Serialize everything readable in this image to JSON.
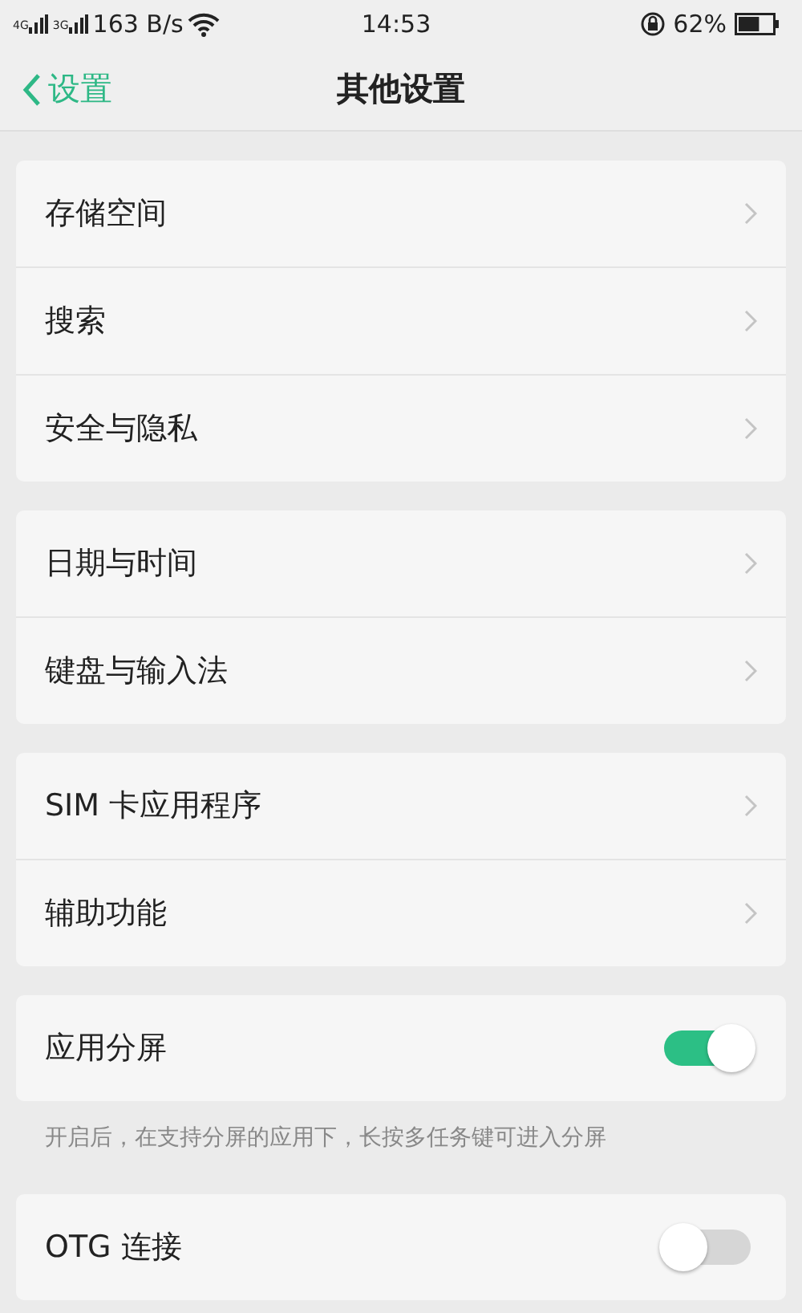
{
  "status_bar": {
    "sim1": "4G",
    "sim2": "3G",
    "speed": "163 B/s",
    "time": "14:53",
    "battery": "62%"
  },
  "header": {
    "back": "设置",
    "title": "其他设置"
  },
  "groups": [
    {
      "rows": [
        {
          "label": "存储空间",
          "kind": "link"
        },
        {
          "label": "搜索",
          "kind": "link"
        },
        {
          "label": "安全与隐私",
          "kind": "link"
        }
      ]
    },
    {
      "rows": [
        {
          "label": "日期与时间",
          "kind": "link"
        },
        {
          "label": "键盘与输入法",
          "kind": "link"
        }
      ]
    },
    {
      "rows": [
        {
          "label": "SIM 卡应用程序",
          "kind": "link"
        },
        {
          "label": "辅助功能",
          "kind": "link"
        }
      ]
    },
    {
      "rows": [
        {
          "label": "应用分屏",
          "kind": "toggle",
          "on": true
        }
      ],
      "note": "开启后，在支持分屏的应用下，长按多任务键可进入分屏"
    },
    {
      "rows": [
        {
          "label": "OTG 连接",
          "kind": "toggle",
          "on": false
        }
      ]
    }
  ]
}
